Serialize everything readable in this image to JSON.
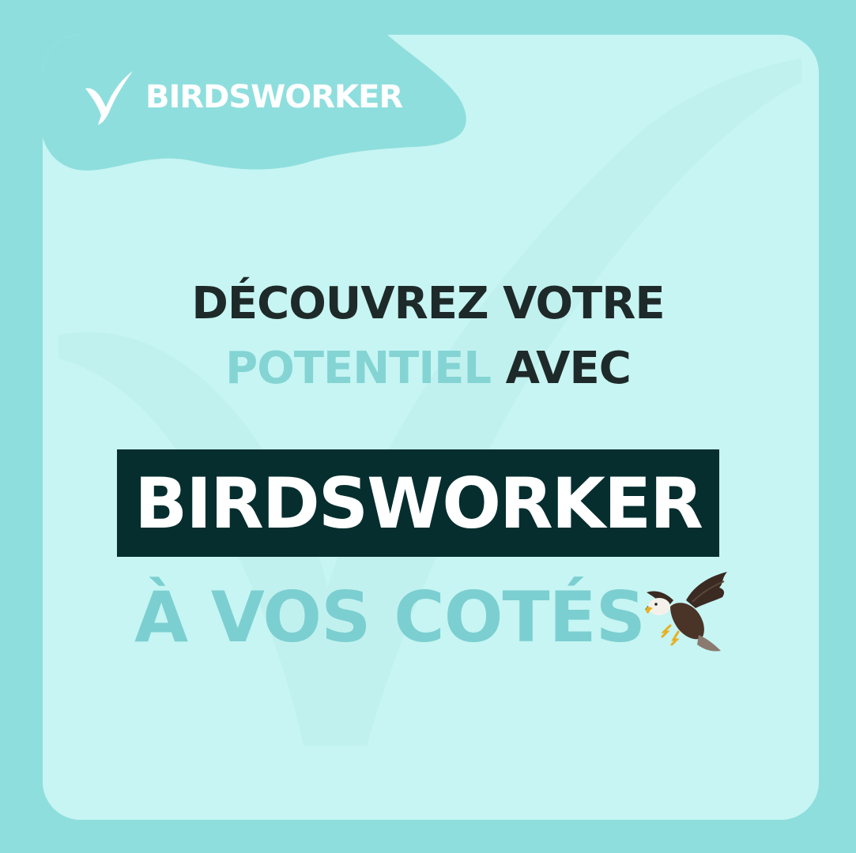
{
  "brand": {
    "name": "BIRDSWORKER",
    "logo_icon": "checkmark-bird-icon"
  },
  "headline": {
    "line1": "DÉCOUVREZ VOTRE",
    "line2_accent": "POTENTIEL",
    "line2_dark": "AVEC",
    "banner": "BIRDSWORKER",
    "line3": "À VOS COTÉS"
  },
  "decoration": {
    "eagle": "eagle-icon",
    "watermark": "checkmark-watermark"
  },
  "colors": {
    "frame": "#8fdede",
    "card": "#c6f5f3",
    "accent": "#84d4d4",
    "dark_text": "#1e2a29",
    "banner_bg": "#062e2e",
    "banner_text": "#ffffff"
  }
}
